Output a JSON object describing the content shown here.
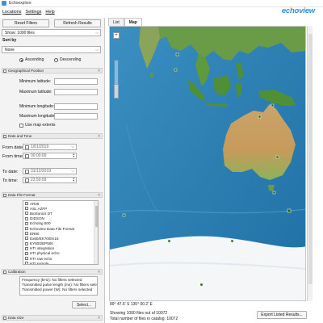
{
  "window": {
    "title": "Echoexplore"
  },
  "menu": [
    "Locations",
    "Settings",
    "Help"
  ],
  "brand": "echoview",
  "toolbar": {
    "reset_label": "Reset Filters",
    "refresh_label": "Refresh Results"
  },
  "show": {
    "value": "Show:  1000 files"
  },
  "sort": {
    "heading": "Sort by",
    "value": "None",
    "ascending": "Ascending",
    "descending": "Descending",
    "selected": "ascending"
  },
  "geo": {
    "header": "Geographical Position",
    "min_lat": "Minimum latitude:",
    "max_lat": "Maximum latitude:",
    "min_lon": "Minimum longitude:",
    "max_lon": "Maximum longitude:",
    "use_extents": "Use map extents"
  },
  "datetime": {
    "header": "Date and Time",
    "from_date_label": "From date:",
    "from_date_value": "1/01/2019",
    "from_time_label": "From time:",
    "from_time_value": "00:00:00",
    "to_date_label": "To date:",
    "to_date_value": "31/12/2019",
    "to_time_label": "To time:",
    "to_time_value": "23:59:59"
  },
  "format": {
    "header": "Data File Format",
    "items": [
      "AR25",
      "ASL AZFP",
      "BioSonics DT",
      "DIDSON",
      "Echolog 500",
      "Echoview Data File Format",
      "ER60",
      "Ex60/EK70/EK15",
      "EY500/EP500",
      "HTI integration",
      "HTI physical echo",
      "HTI raw echo",
      "HTI sample"
    ]
  },
  "calibration": {
    "header": "Calibration",
    "lines": [
      "Frequency (kHz):  No filters selected",
      "Transmitted pulse length (ms):  No filters selected",
      "Transmitted power (W):  No filters selected"
    ],
    "select_label": "Select..."
  },
  "datasize": {
    "header": "Data Size"
  },
  "tabs": [
    "List",
    "Map"
  ],
  "active_tab": "Map",
  "map": {
    "coordinates": "89° 47.6' S 135° 00.2' E"
  },
  "status": {
    "showing": "Showing 1000 files out of 10072",
    "total": "Total number of files in catalog: 10072",
    "export_label": "Export Listed Results..."
  },
  "colors": {
    "accent": "#2f8fd8",
    "ocean": "#2f84b6",
    "land": "#5f9a3c",
    "desert": "#c9a96e",
    "ice": "#f4f6f7"
  }
}
